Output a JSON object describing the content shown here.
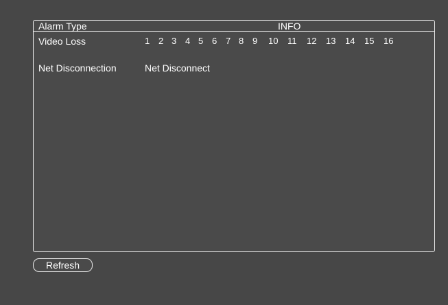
{
  "table": {
    "header": {
      "alarm_type": "Alarm Type",
      "info": "INFO"
    },
    "rows": [
      {
        "type": "Video Loss",
        "channels": [
          "1",
          "2",
          "3",
          "4",
          "5",
          "6",
          "7",
          "8",
          "9",
          "10",
          "11",
          "12",
          "13",
          "14",
          "15",
          "16"
        ]
      },
      {
        "type": "Net Disconnection",
        "info": "Net Disconnect"
      }
    ]
  },
  "actions": {
    "refresh_label": "Refresh"
  }
}
